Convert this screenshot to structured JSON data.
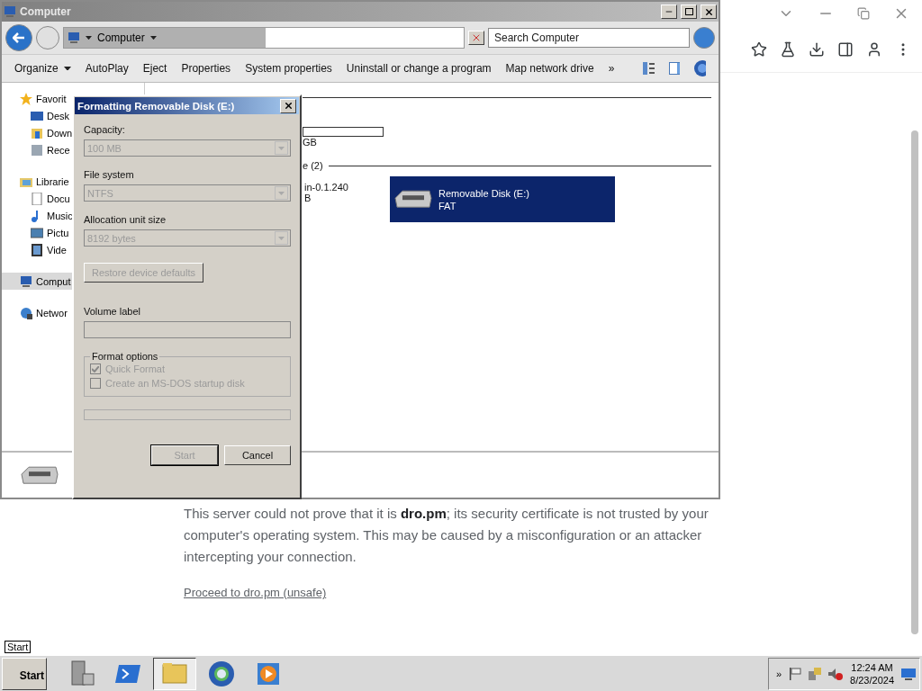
{
  "browser": {
    "message": "This server could not prove that it is **dro.pm**; its security certificate is not trusted by your computer's operating system. This may be caused by a misconfiguration or an attacker intercepting your connection.",
    "link": "Proceed to dro.pm (unsafe)"
  },
  "explorer": {
    "title": "Computer",
    "address": {
      "crumb": "Computer"
    },
    "search": {
      "placeholder": "Search Computer"
    },
    "toolbar": [
      {
        "label": "Organize",
        "kind": "menu"
      },
      {
        "label": "AutoPlay",
        "kind": "action"
      },
      {
        "label": "Eject",
        "kind": "action"
      },
      {
        "label": "Properties",
        "kind": "action"
      },
      {
        "label": "System properties",
        "kind": "action"
      },
      {
        "label": "Uninstall or change a program",
        "kind": "action"
      },
      {
        "label": "Map network drive",
        "kind": "action"
      },
      {
        "label": "»",
        "kind": "more"
      }
    ],
    "nav": [
      {
        "label": "Favorit",
        "kind": "star",
        "selected": false,
        "children": [
          {
            "label": "Desk",
            "kind": "desktop",
            "selected": false
          },
          {
            "label": "Down",
            "kind": "download",
            "selected": false
          },
          {
            "label": "Rece",
            "kind": "recent",
            "selected": false
          }
        ]
      },
      {
        "label": "Librarie",
        "kind": "library",
        "selected": false,
        "children": [
          {
            "label": "Docu",
            "kind": "document",
            "selected": false
          },
          {
            "label": "Music",
            "kind": "music",
            "selected": false
          },
          {
            "label": "Pictu",
            "kind": "picture",
            "selected": false
          },
          {
            "label": "Vide",
            "kind": "video",
            "selected": false
          }
        ]
      },
      {
        "label": "Comput",
        "kind": "computer",
        "selected": true
      },
      {
        "label": "Networ",
        "kind": "network",
        "selected": false
      }
    ],
    "content": {
      "hard_disk": {
        "size": "GB"
      },
      "group_header": "e (2)",
      "items": [
        {
          "kind": "partial",
          "name": "in-0.1.240",
          "detail": "B",
          "selected": false
        },
        {
          "kind": "drive",
          "name": "Removable Disk (E:)",
          "detail": "FAT",
          "selected": true
        }
      ]
    }
  },
  "dialog": {
    "title": "Formatting Removable Disk (E:)",
    "fields": [
      {
        "label": "Capacity:",
        "value": "100 MB",
        "disabled": true
      },
      {
        "label": "File system",
        "value": "NTFS",
        "disabled": true
      },
      {
        "label": "Allocation unit size",
        "value": "8192 bytes",
        "disabled": true
      }
    ],
    "restore": {
      "label": "Restore device defaults",
      "disabled": true
    },
    "volume": {
      "label": "Volume label",
      "disabled": true
    },
    "options": {
      "title": "Format options",
      "items": [
        {
          "label": "Quick Format",
          "checked": true,
          "disabled": true
        },
        {
          "label": "Create an MS-DOS startup disk",
          "checked": false,
          "disabled": true
        }
      ]
    },
    "progress": {
      "level": 0
    },
    "buttons": [
      {
        "label": "Start",
        "disabled": true
      },
      {
        "label": "Cancel",
        "disabled": false
      }
    ]
  },
  "taskbar": {
    "start": "Start",
    "tooltip": "Start",
    "apps": [
      {
        "kind": "server",
        "selected": false
      },
      {
        "kind": "terminal",
        "selected": false
      },
      {
        "kind": "folder",
        "selected": true
      },
      {
        "kind": "globe",
        "selected": false
      },
      {
        "kind": "media",
        "selected": false
      }
    ],
    "tray": {
      "expand": "»",
      "time": "12:24 AM",
      "date": "8/23/2024",
      "muted": true
    }
  }
}
